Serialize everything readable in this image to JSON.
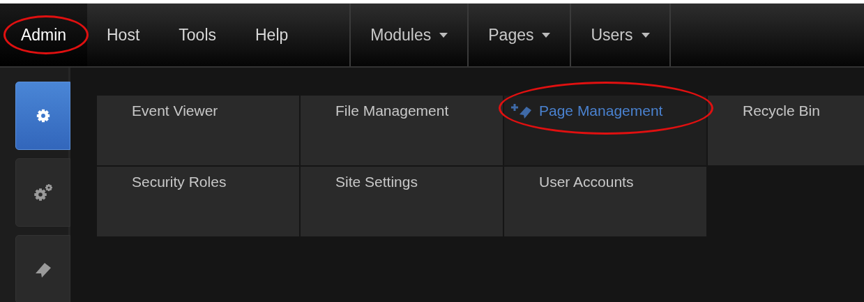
{
  "main_menu": [
    {
      "label": "Admin",
      "selected": true,
      "circled": true
    },
    {
      "label": "Host",
      "selected": false,
      "circled": false
    },
    {
      "label": "Tools",
      "selected": false,
      "circled": false
    },
    {
      "label": "Help",
      "selected": false,
      "circled": false
    }
  ],
  "dropdown_menus": [
    {
      "label": "Modules"
    },
    {
      "label": "Pages"
    },
    {
      "label": "Users"
    }
  ],
  "sidebar": {
    "items": [
      {
        "kind": "gear",
        "selected": true
      },
      {
        "kind": "gears",
        "selected": false
      },
      {
        "kind": "tag",
        "selected": false
      }
    ]
  },
  "admin_items": [
    {
      "label": "Event Viewer",
      "hovered": false,
      "circled": false
    },
    {
      "label": "File Management",
      "hovered": false,
      "circled": false
    },
    {
      "label": "Page Management",
      "hovered": true,
      "circled": true
    },
    {
      "label": "Recycle Bin",
      "hovered": false,
      "circled": false
    },
    {
      "label": "Security Roles",
      "hovered": false,
      "circled": false
    },
    {
      "label": "Site Settings",
      "hovered": false,
      "circled": false
    },
    {
      "label": "User Accounts",
      "hovered": false,
      "circled": false
    }
  ]
}
